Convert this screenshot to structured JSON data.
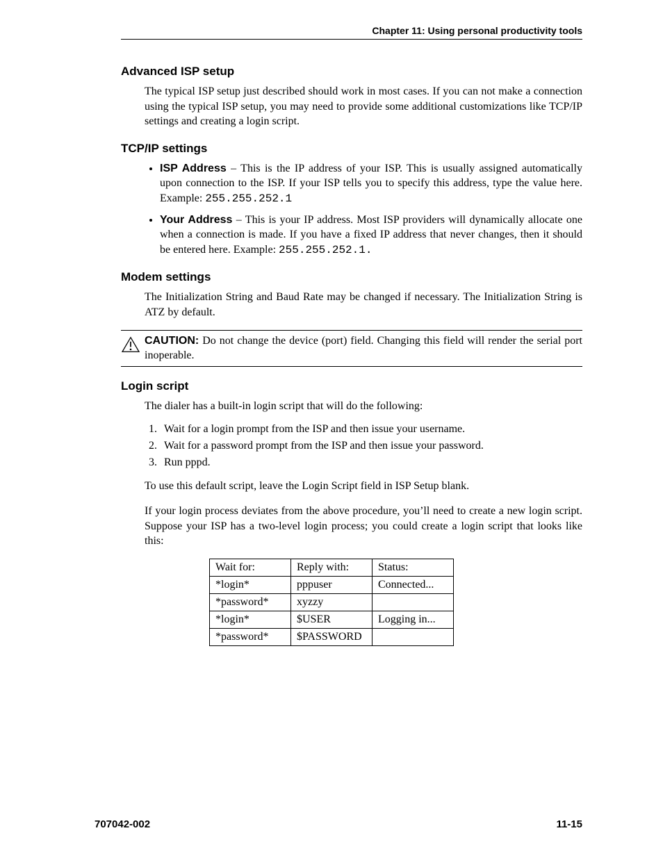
{
  "header": {
    "chapter": "Chapter 11: Using personal productivity tools"
  },
  "sections": {
    "adv_isp": {
      "title": "Advanced ISP setup",
      "p1": "The typical ISP setup just described should work in most cases. If you can not make a connection using the typical ISP setup, you may need to provide some additional customizations like TCP/IP settings and creating a login script."
    },
    "tcpip": {
      "title": "TCP/IP settings",
      "items": [
        {
          "label": "ISP Address",
          "text": " – This is the IP address of your ISP. This is usually assigned automatically upon connection to the ISP. If your ISP tells you to specify this address, type the value here. Example: ",
          "code": "255.255.252.1"
        },
        {
          "label": "Your Address",
          "text": " – This is your IP address. Most ISP providers will dynamically allocate one when a connection is made. If you have a fixed IP address that never changes, then it should be entered here. Example: ",
          "code": "255.255.252.1."
        }
      ]
    },
    "modem": {
      "title": "Modem settings",
      "p1": "The Initialization String and Baud Rate may be changed if necessary. The Initialization String is ATZ by default."
    },
    "caution": {
      "label": "CAUTION:",
      "text": " Do not change the device (port) field. Changing this field will render the serial port inoperable."
    },
    "login": {
      "title": "Login script",
      "p1": "The dialer has a built-in login script that will do the following:",
      "steps": [
        "Wait for a login prompt from the ISP and then issue your username.",
        "Wait for a password prompt from the ISP and then issue your password.",
        "Run pppd."
      ],
      "p2": "To use this default script, leave the Login Script field in ISP Setup blank.",
      "p3": "If your login process deviates from the above procedure, you’ll need to create a new login script. Suppose your ISP has a two-level login process; you could create a login script that looks like this:",
      "table": {
        "headers": [
          "Wait for:",
          "Reply with:",
          "Status:"
        ],
        "rows": [
          [
            "*login*",
            "pppuser",
            "Connected..."
          ],
          [
            "*password*",
            "xyzzy",
            ""
          ],
          [
            "*login*",
            "$USER",
            "Logging in..."
          ],
          [
            "*password*",
            "$PASSWORD",
            ""
          ]
        ]
      }
    }
  },
  "footer": {
    "docnum": "707042-002",
    "pagenum": "11-15"
  }
}
